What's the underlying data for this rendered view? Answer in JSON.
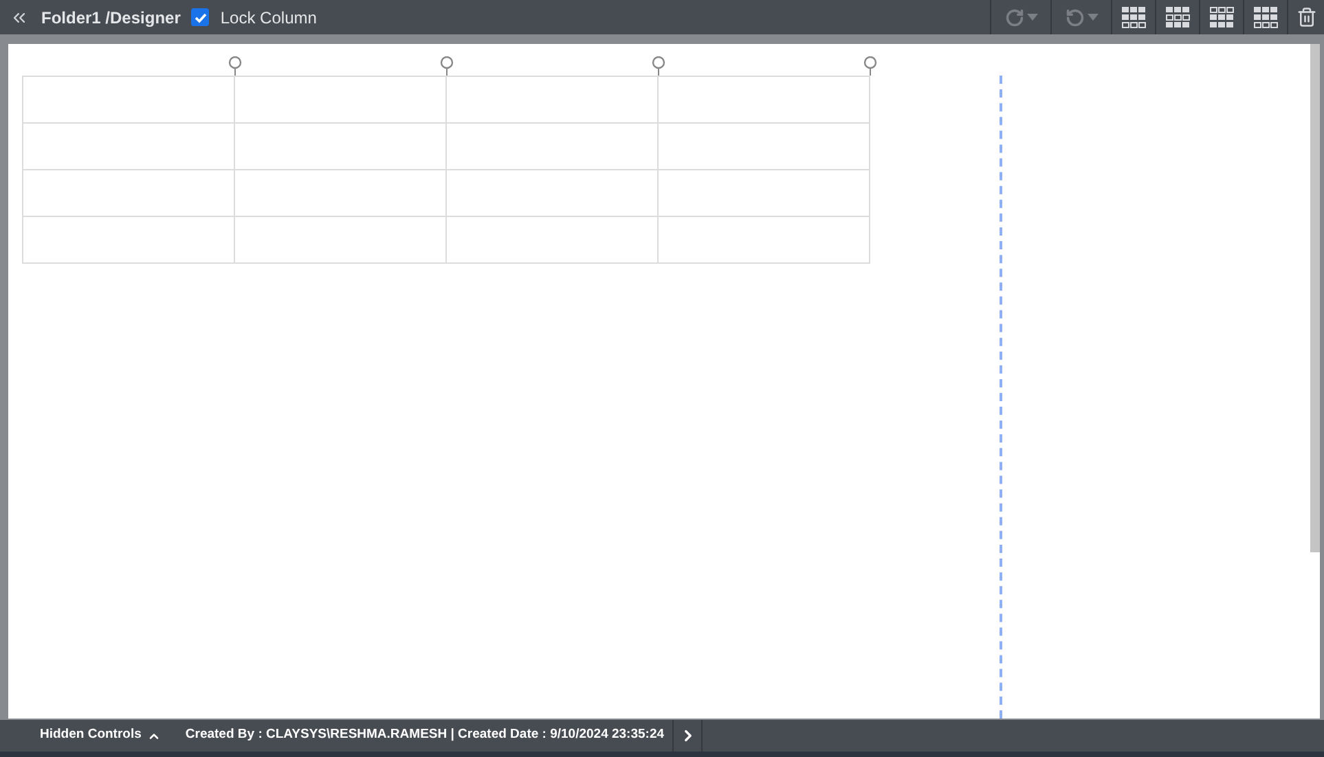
{
  "header": {
    "title": "Folder1 /Designer",
    "lock_column": {
      "label": "Lock Column",
      "checked": true
    }
  },
  "status_bar": {
    "hidden_controls": "Hidden Controls",
    "info": "Created By : CLAYSYS\\RESHMA.RAMESH | Created Date : 9/10/2024 23:35:24"
  }
}
